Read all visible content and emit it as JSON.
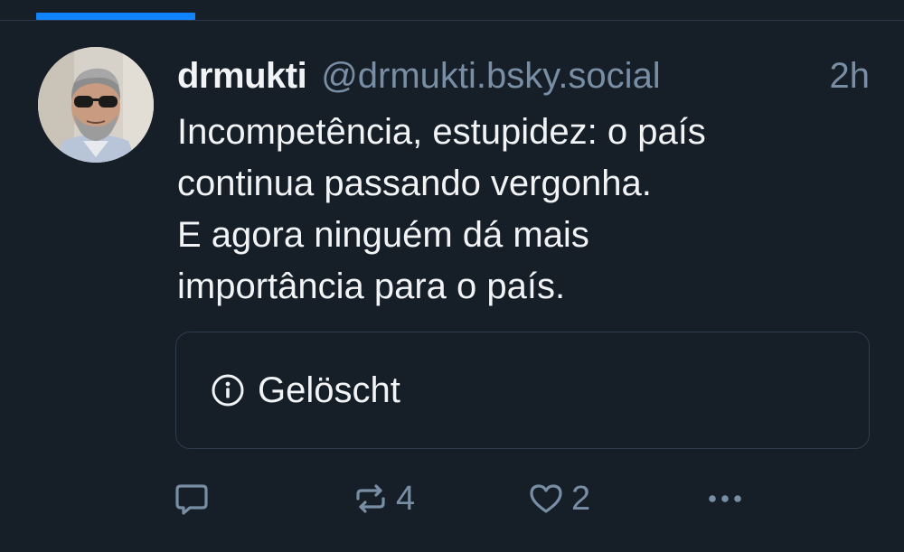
{
  "post": {
    "author": {
      "display_name": "drmukti",
      "handle": "@drmukti.bsky.social"
    },
    "timestamp": "2h",
    "text_lines": [
      "Incompetência, estupidez: o país",
      "continua passando vergonha.",
      "E agora ninguém dá mais",
      "importância para o país."
    ],
    "embed": {
      "icon": "info-circle-icon",
      "label": "Gelöscht"
    },
    "actions": {
      "reply": {
        "icon": "speech-bubble-icon"
      },
      "repost": {
        "icon": "repost-arrows-icon",
        "count": "4"
      },
      "like": {
        "icon": "heart-icon",
        "count": "2"
      },
      "more": {
        "icon": "ellipsis-icon"
      }
    }
  },
  "colors": {
    "background": "#161e27",
    "accent": "#1083fe",
    "text_primary": "#f1f3f5",
    "text_secondary": "#788ea5",
    "border": "#2e3d4f"
  }
}
